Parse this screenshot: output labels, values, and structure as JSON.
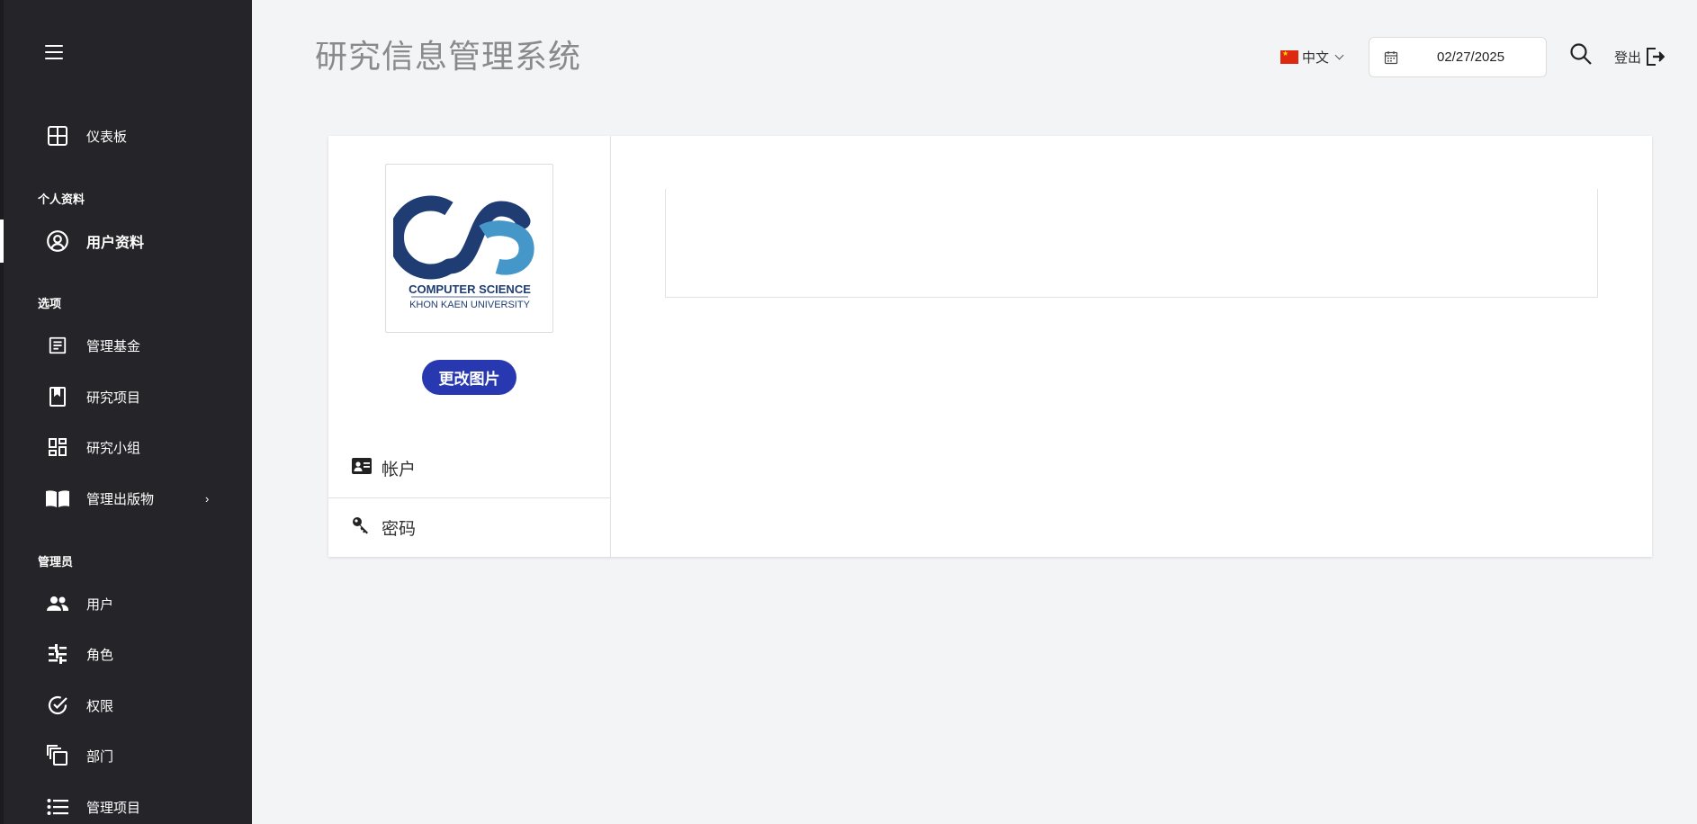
{
  "app": {
    "title": "研究信息管理系统"
  },
  "header": {
    "language": "中文",
    "date": "02/27/2025",
    "logout_label": "登出"
  },
  "sidebar": {
    "dashboard": "仪表板",
    "section_profile": "个人资料",
    "profile": "用户资料",
    "section_options": "选项",
    "manage_funds": "管理基金",
    "research_projects": "研究项目",
    "research_groups": "研究小组",
    "manage_publications": "管理出版物",
    "section_admin": "管理员",
    "users": "用户",
    "roles": "角色",
    "permissions": "权限",
    "departments": "部门",
    "manage_programs": "管理项目"
  },
  "profile_card": {
    "logo_line1": "COMPUTER SCIENCE",
    "logo_line2": "KHON KAEN UNIVERSITY",
    "change_image_label": "更改图片",
    "tabs": [
      {
        "label": "帐户",
        "icon": "id-card-icon"
      },
      {
        "label": "密码",
        "icon": "key-icon"
      }
    ]
  },
  "colors": {
    "sidebar_bg": "#252529",
    "page_bg": "#f3f4f6",
    "primary_button": "#2838b0",
    "logo_dark": "#1f3d73",
    "logo_light": "#4596c9"
  }
}
